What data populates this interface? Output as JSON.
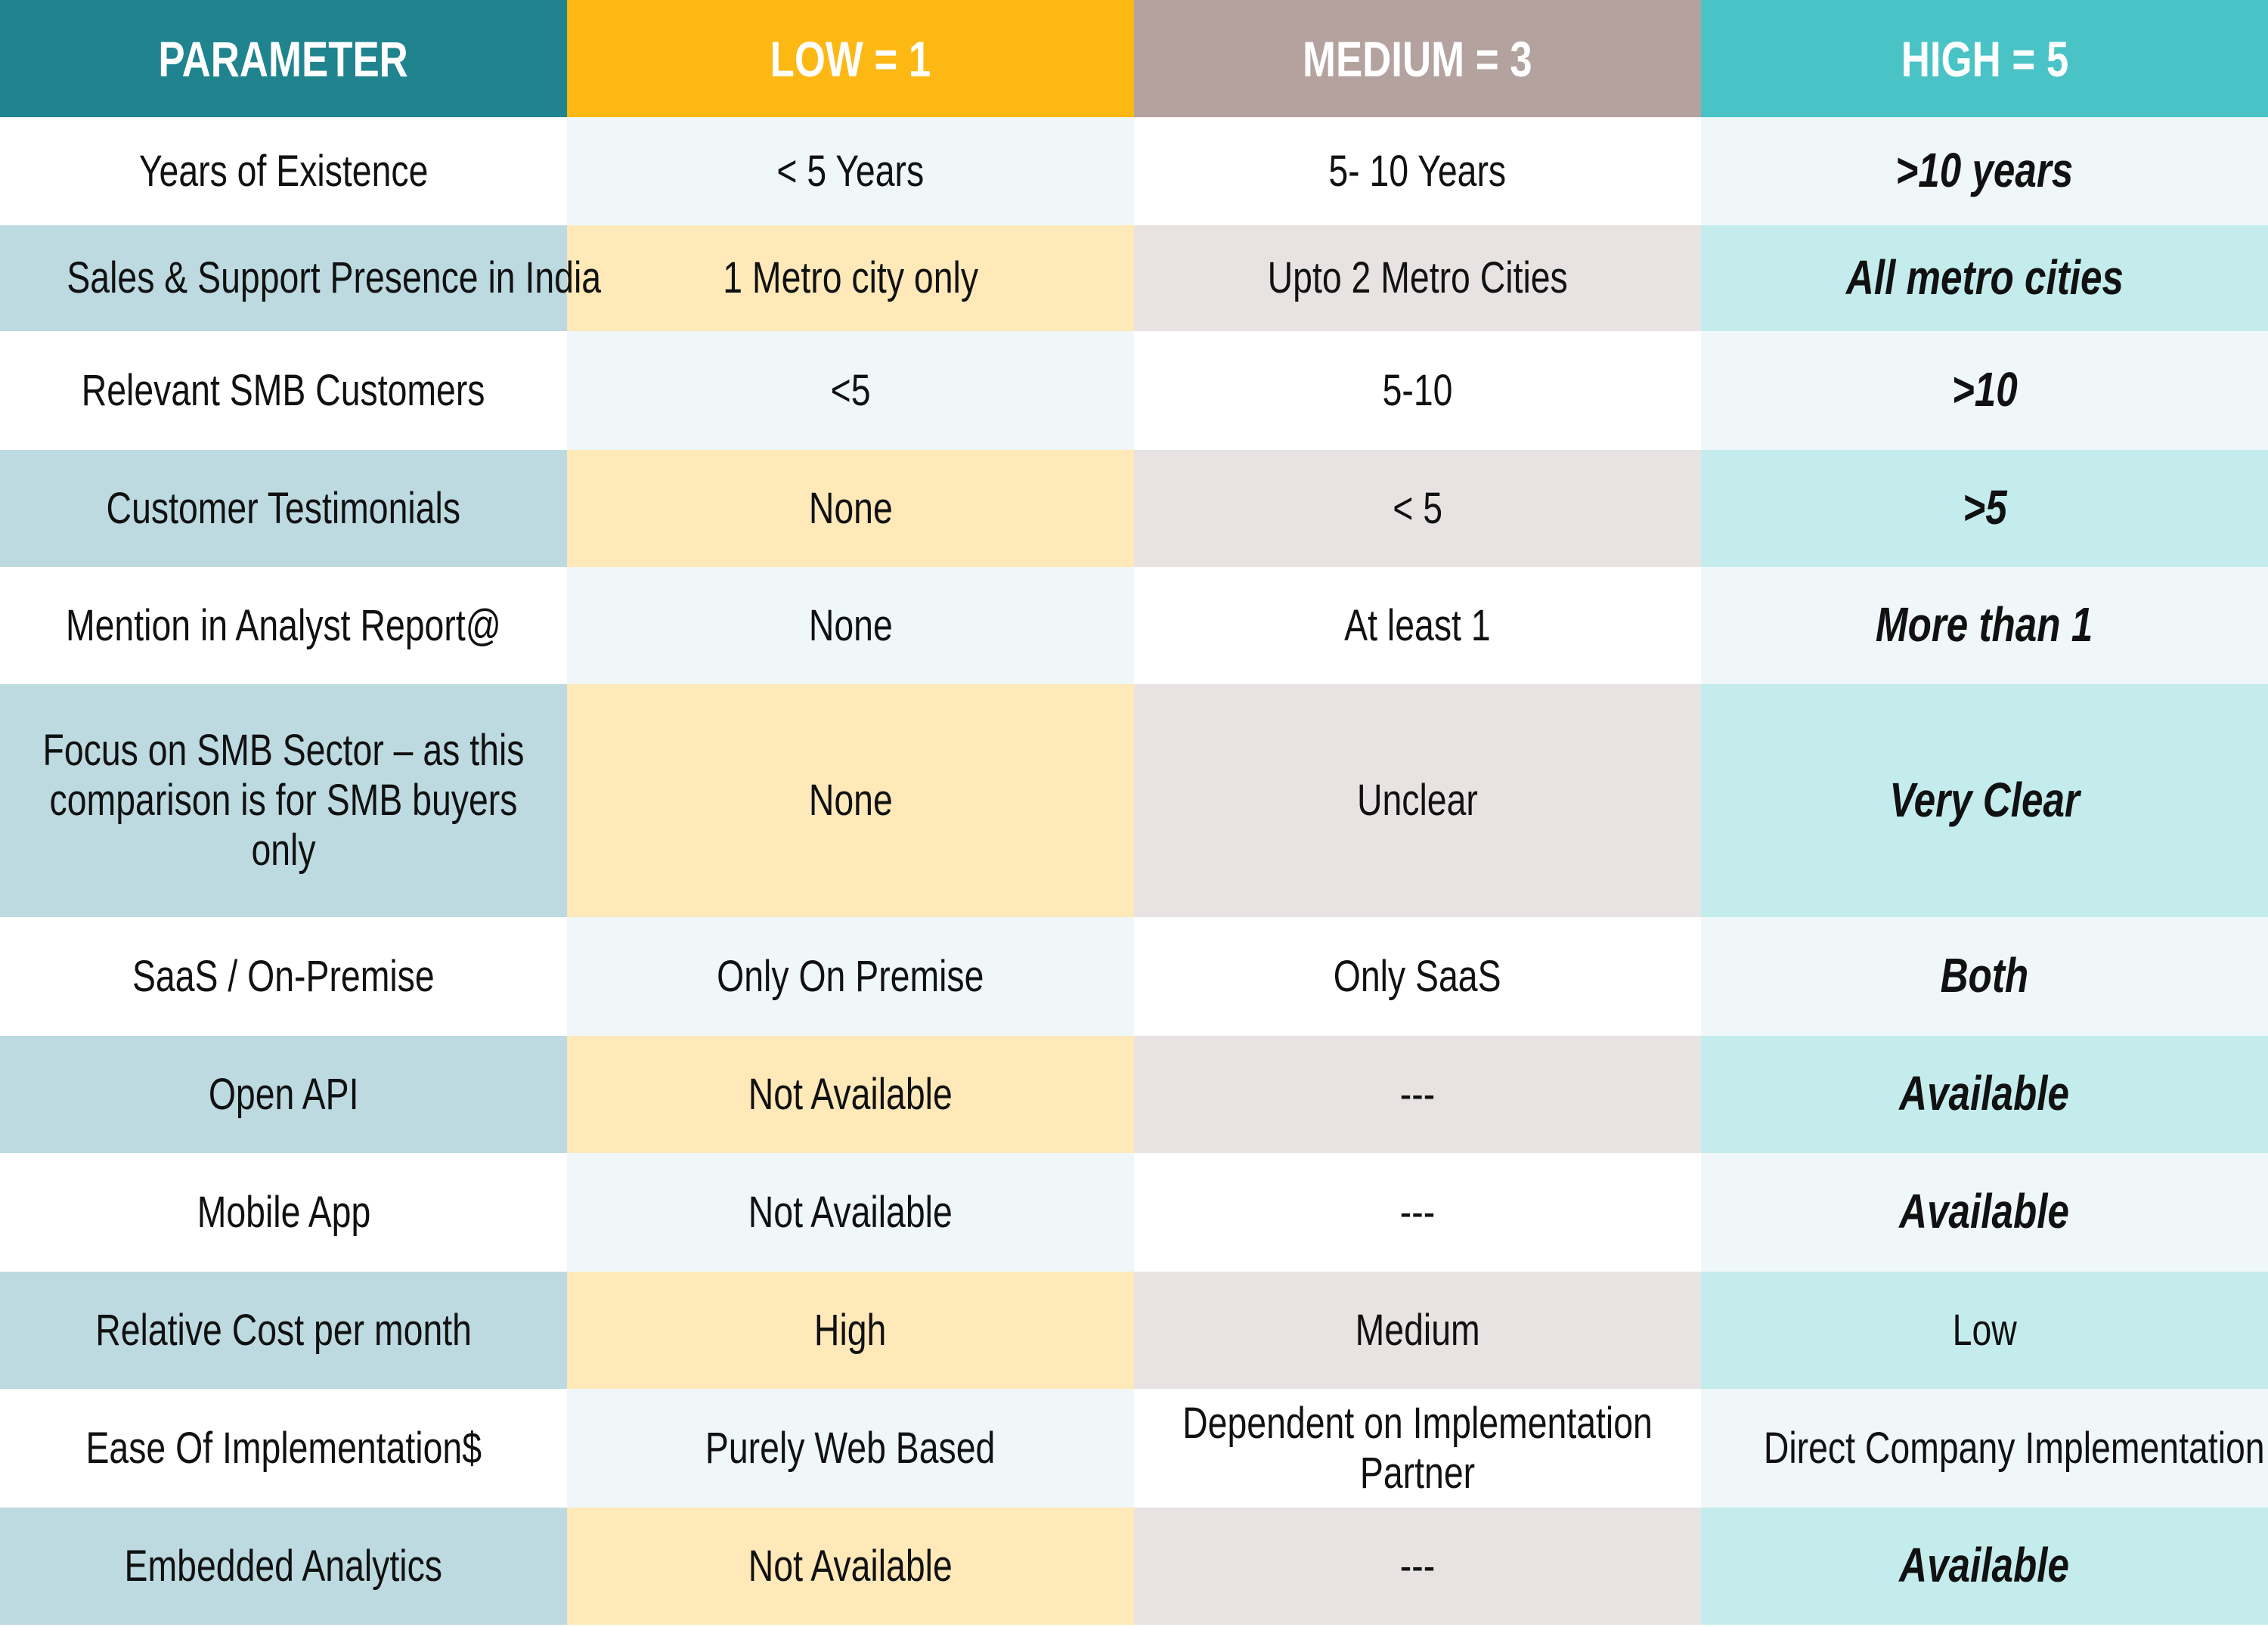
{
  "colors": {
    "parameter_header": "#20848F",
    "low_header": "#FDB813",
    "medium_header": "#B3A29E",
    "high_header": "#4AC3C6"
  },
  "headers": [
    "PARAMETER",
    "LOW = 1",
    "MEDIUM = 3",
    "HIGH = 5"
  ],
  "rows": [
    {
      "parameter": "Years of Existence",
      "low": "< 5 Years",
      "medium": "5- 10 Years",
      "high": ">10 years",
      "high_emphasis": true
    },
    {
      "parameter": "Sales & Support Presence in India",
      "low": "1 Metro city only",
      "medium": "Upto 2 Metro Cities",
      "high": "All metro cities",
      "high_emphasis": true
    },
    {
      "parameter": "Relevant SMB Customers",
      "low": "<5",
      "medium": "5-10",
      "high": ">10",
      "high_emphasis": true
    },
    {
      "parameter": "Customer Testimonials",
      "low": "None",
      "medium": "< 5",
      "high": ">5",
      "high_emphasis": true
    },
    {
      "parameter": "Mention in Analyst Report@",
      "low": "None",
      "medium": "At least 1",
      "high": "More than 1",
      "high_emphasis": true
    },
    {
      "parameter": "Focus on SMB Sector – as this comparison is for SMB buyers only",
      "low": "None",
      "medium": "Unclear",
      "high": "Very Clear",
      "high_emphasis": true
    },
    {
      "parameter": "SaaS / On-Premise",
      "low": "Only On Premise",
      "medium": "Only SaaS",
      "high": "Both",
      "high_emphasis": true
    },
    {
      "parameter": "Open API",
      "low": "Not Available",
      "medium": "---",
      "high": "Available",
      "high_emphasis": true
    },
    {
      "parameter": "Mobile App",
      "low": "Not Available",
      "medium": "---",
      "high": "Available",
      "high_emphasis": true
    },
    {
      "parameter": "Relative Cost per month",
      "low": "High",
      "medium": "Medium",
      "high": "Low",
      "high_emphasis": false
    },
    {
      "parameter": "Ease Of Implementation$",
      "low": "Purely Web Based",
      "medium": "Dependent on Implementation Partner",
      "high": "Direct Company Implementation",
      "high_emphasis": false
    },
    {
      "parameter": "Embedded Analytics",
      "low": "Not Available",
      "medium": "---",
      "high": "Available",
      "high_emphasis": true
    }
  ]
}
